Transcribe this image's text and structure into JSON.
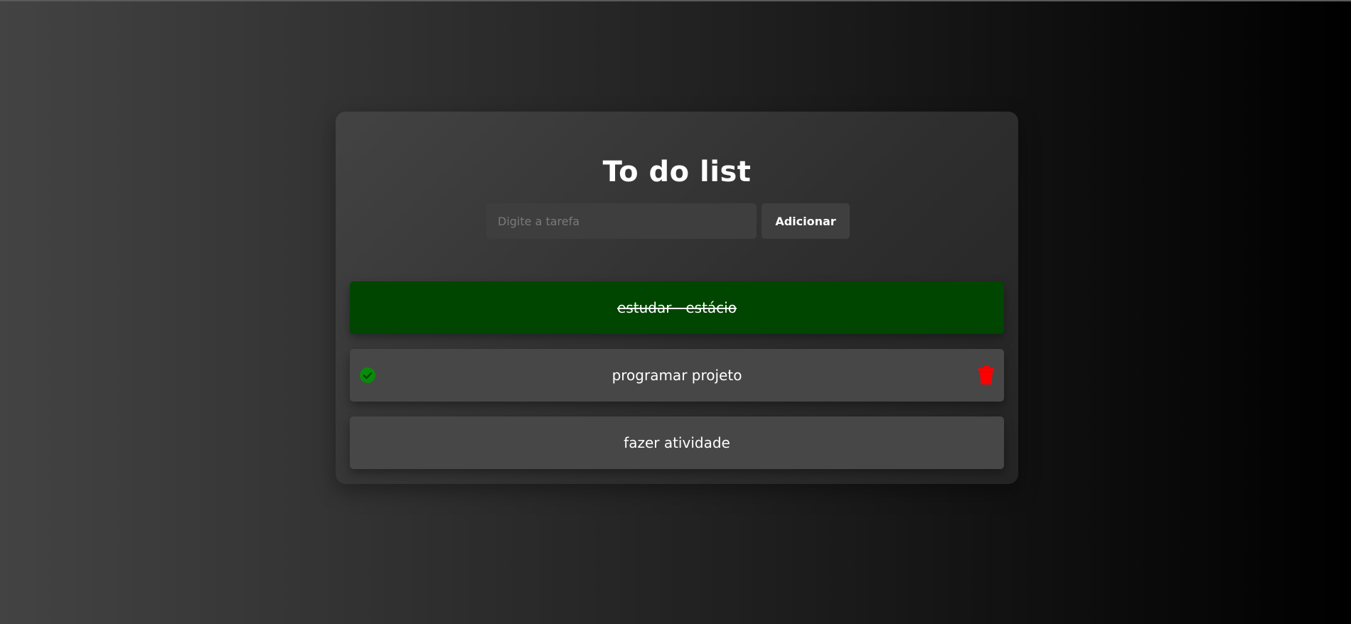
{
  "app": {
    "title": "To do list"
  },
  "form": {
    "input_placeholder": "Digite a tarefa",
    "input_value": "",
    "add_label": "Adicionar"
  },
  "tasks": [
    {
      "text": "estudar - estácio",
      "done": true
    },
    {
      "text": "programar projeto",
      "done": false,
      "hovered": true
    },
    {
      "text": "fazer atividade",
      "done": false
    }
  ],
  "icons": {
    "complete": "check-circle-icon",
    "delete": "trash-icon"
  },
  "colors": {
    "done_background": "#004500",
    "task_background": "#474747",
    "check_icon": "#0a8a0a",
    "trash_icon": "#ff0000"
  }
}
